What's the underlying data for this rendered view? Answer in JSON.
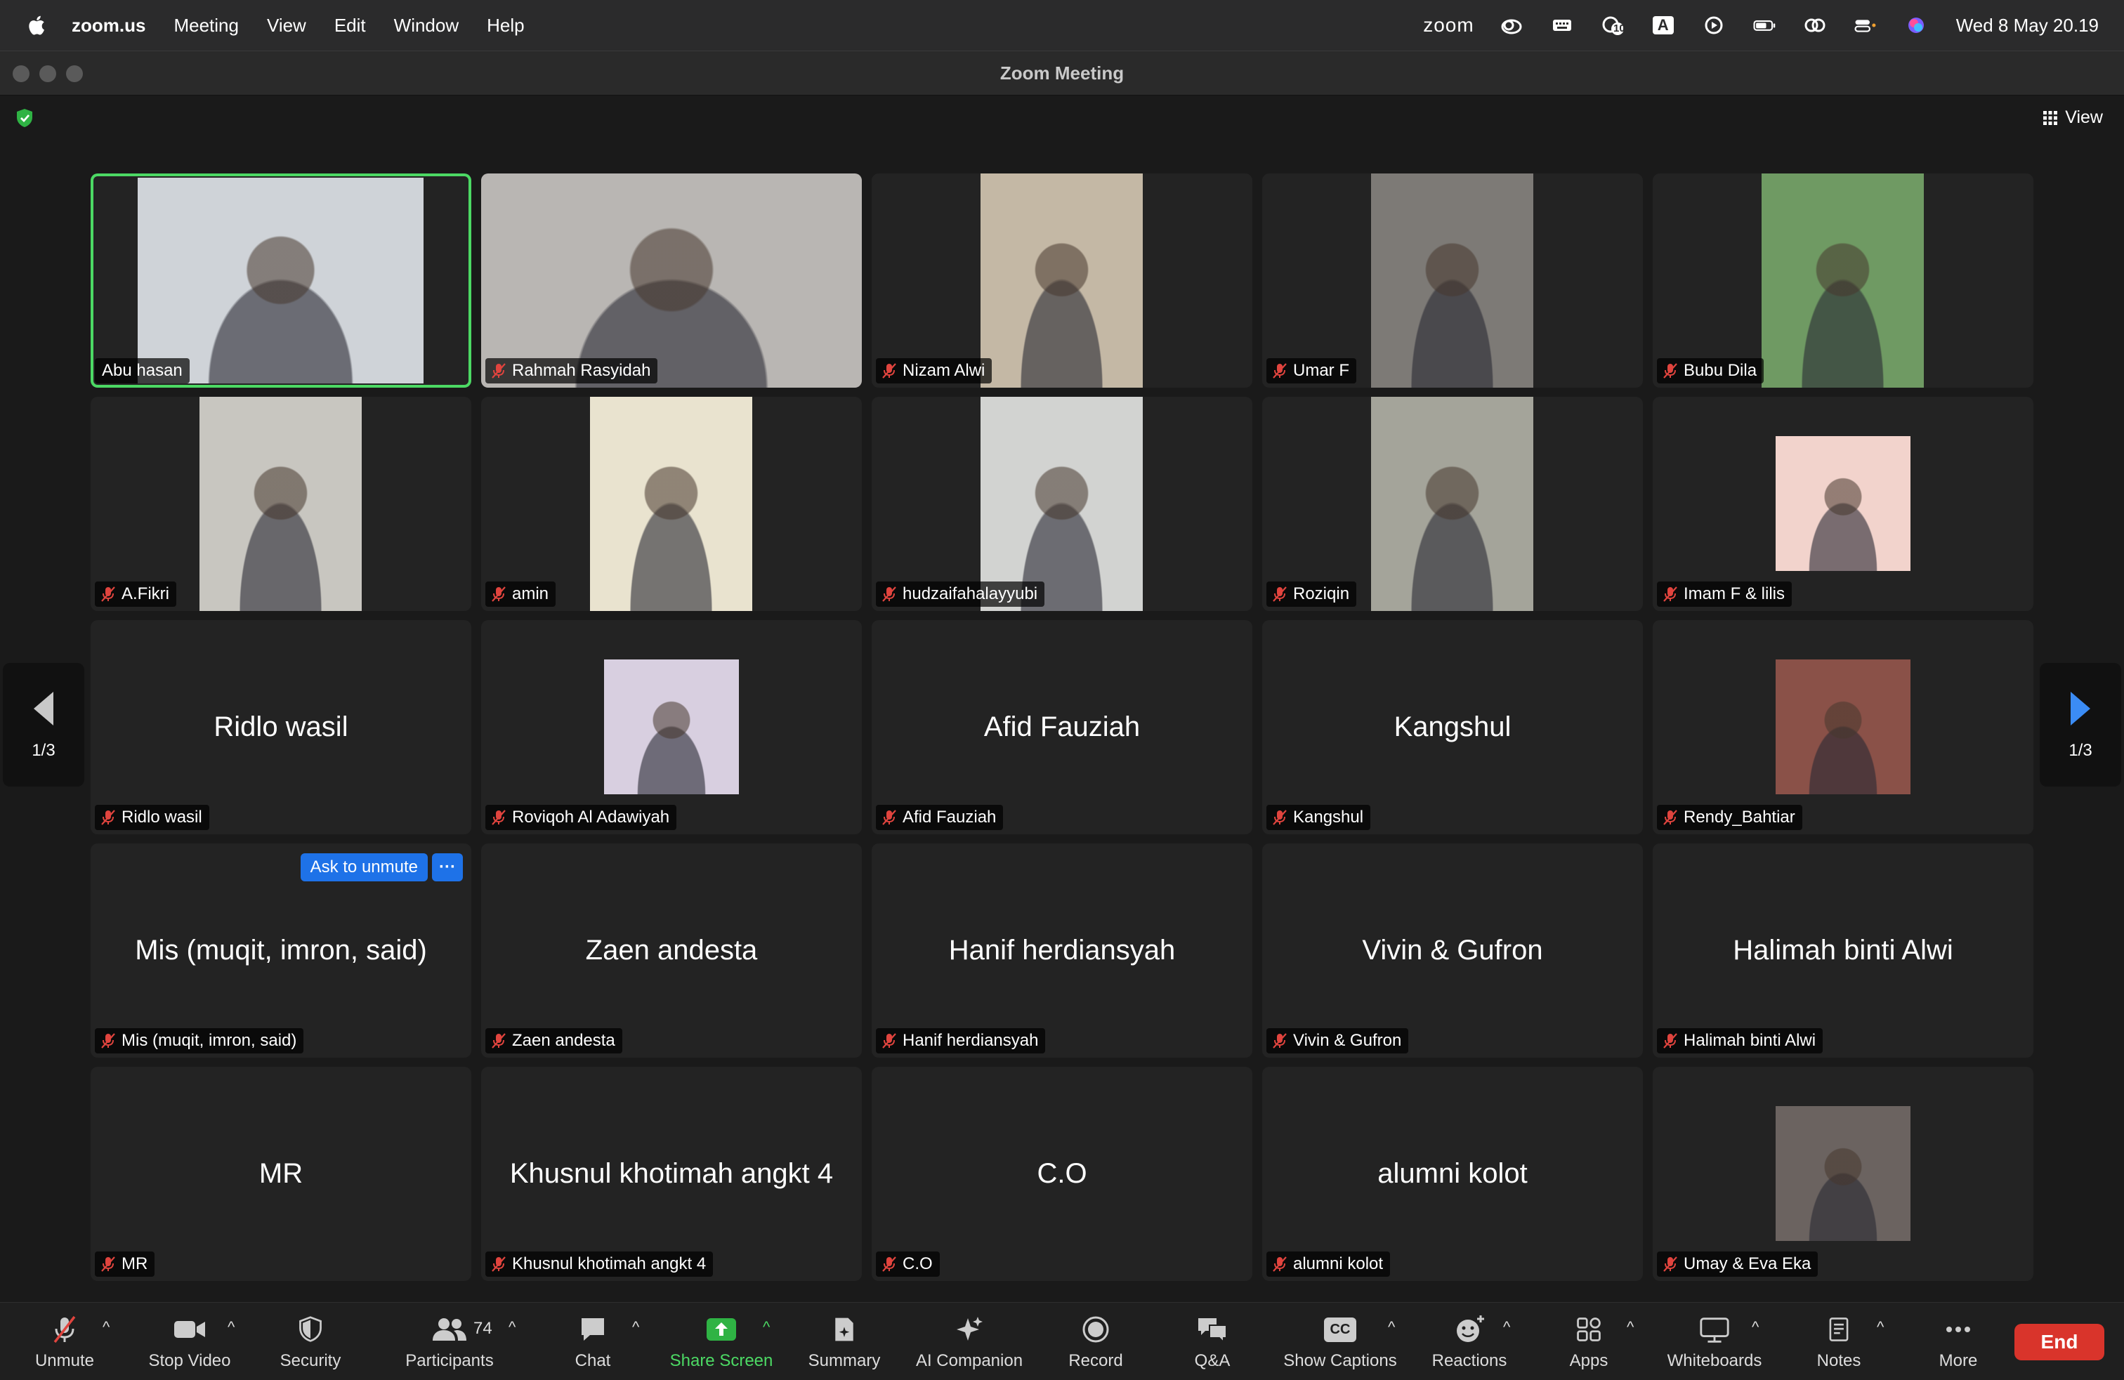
{
  "menubar": {
    "app_name": "zoom.us",
    "items": [
      "Meeting",
      "View",
      "Edit",
      "Window",
      "Help"
    ],
    "zoom_word": "zoom",
    "clock": "Wed 8 May  20.19",
    "badge": "10",
    "input_letter": "A"
  },
  "window": {
    "title": "Zoom Meeting",
    "view_label": "View"
  },
  "pager": {
    "page": "1/3"
  },
  "tiles": [
    {
      "name": "Abu hasan",
      "active": true,
      "muted": false,
      "video": "#cfd3d8"
    },
    {
      "name": "Rahmah Rasyidah",
      "muted": true,
      "video": "#b9b6b3"
    },
    {
      "name": "Nizam Alwi",
      "muted": true,
      "video": "#c4b8a5"
    },
    {
      "name": "Umar F",
      "muted": true,
      "video": "#7d7a76"
    },
    {
      "name": "Bubu Dila",
      "muted": true,
      "video": "#6f9a63"
    },
    {
      "name": "A.Fikri",
      "muted": true,
      "video": "#c8c6c0"
    },
    {
      "name": "amin",
      "muted": true,
      "video": "#e9e3cf"
    },
    {
      "name": "hudzaifahalayyubi",
      "muted": true,
      "video": "#d2d3d1"
    },
    {
      "name": "Roziqin",
      "muted": true,
      "video": "#a4a49a"
    },
    {
      "name": "Imam F & lilis",
      "muted": true,
      "video": "#f2d3cc"
    },
    {
      "name": "Ridlo wasil",
      "muted": true
    },
    {
      "name": "Roviqoh Al Adawiyah",
      "muted": true,
      "video": "#d8cfe0"
    },
    {
      "name": "Afid Fauziah",
      "muted": true
    },
    {
      "name": "Kangshul",
      "muted": true
    },
    {
      "name": "Rendy_Bahtiar",
      "muted": true,
      "video": "#8a5148"
    },
    {
      "name": "Mis (muqit, imron, said)",
      "muted": true,
      "ask": "Ask to unmute"
    },
    {
      "name": "Zaen andesta",
      "muted": true
    },
    {
      "name": "Hanif herdiansyah",
      "muted": true
    },
    {
      "name": "Vivin & Gufron",
      "muted": true
    },
    {
      "name": "Halimah binti Alwi",
      "muted": true
    },
    {
      "name": "MR",
      "muted": true
    },
    {
      "name": "Khusnul khotimah angkt 4",
      "muted": true
    },
    {
      "name": "C.O",
      "muted": true
    },
    {
      "name": "alumni kolot",
      "muted": true
    },
    {
      "name": "Umay & Eva Eka",
      "muted": true,
      "video": "#6b6360"
    }
  ],
  "toolbar": {
    "unmute": "Unmute",
    "stop_video": "Stop Video",
    "security": "Security",
    "participants": "Participants",
    "participants_count": "74",
    "chat": "Chat",
    "share_screen": "Share Screen",
    "summary": "Summary",
    "ai_companion": "AI Companion",
    "record": "Record",
    "qa": "Q&A",
    "show_captions": "Show Captions",
    "cc": "CC",
    "reactions": "Reactions",
    "apps": "Apps",
    "whiteboards": "Whiteboards",
    "notes": "Notes",
    "more": "More",
    "end": "End"
  },
  "colors": {
    "accent_blue": "#1e72e8",
    "active_speaker": "#4cd964",
    "end_red": "#d9342b",
    "mute_red": "#e0443e"
  }
}
